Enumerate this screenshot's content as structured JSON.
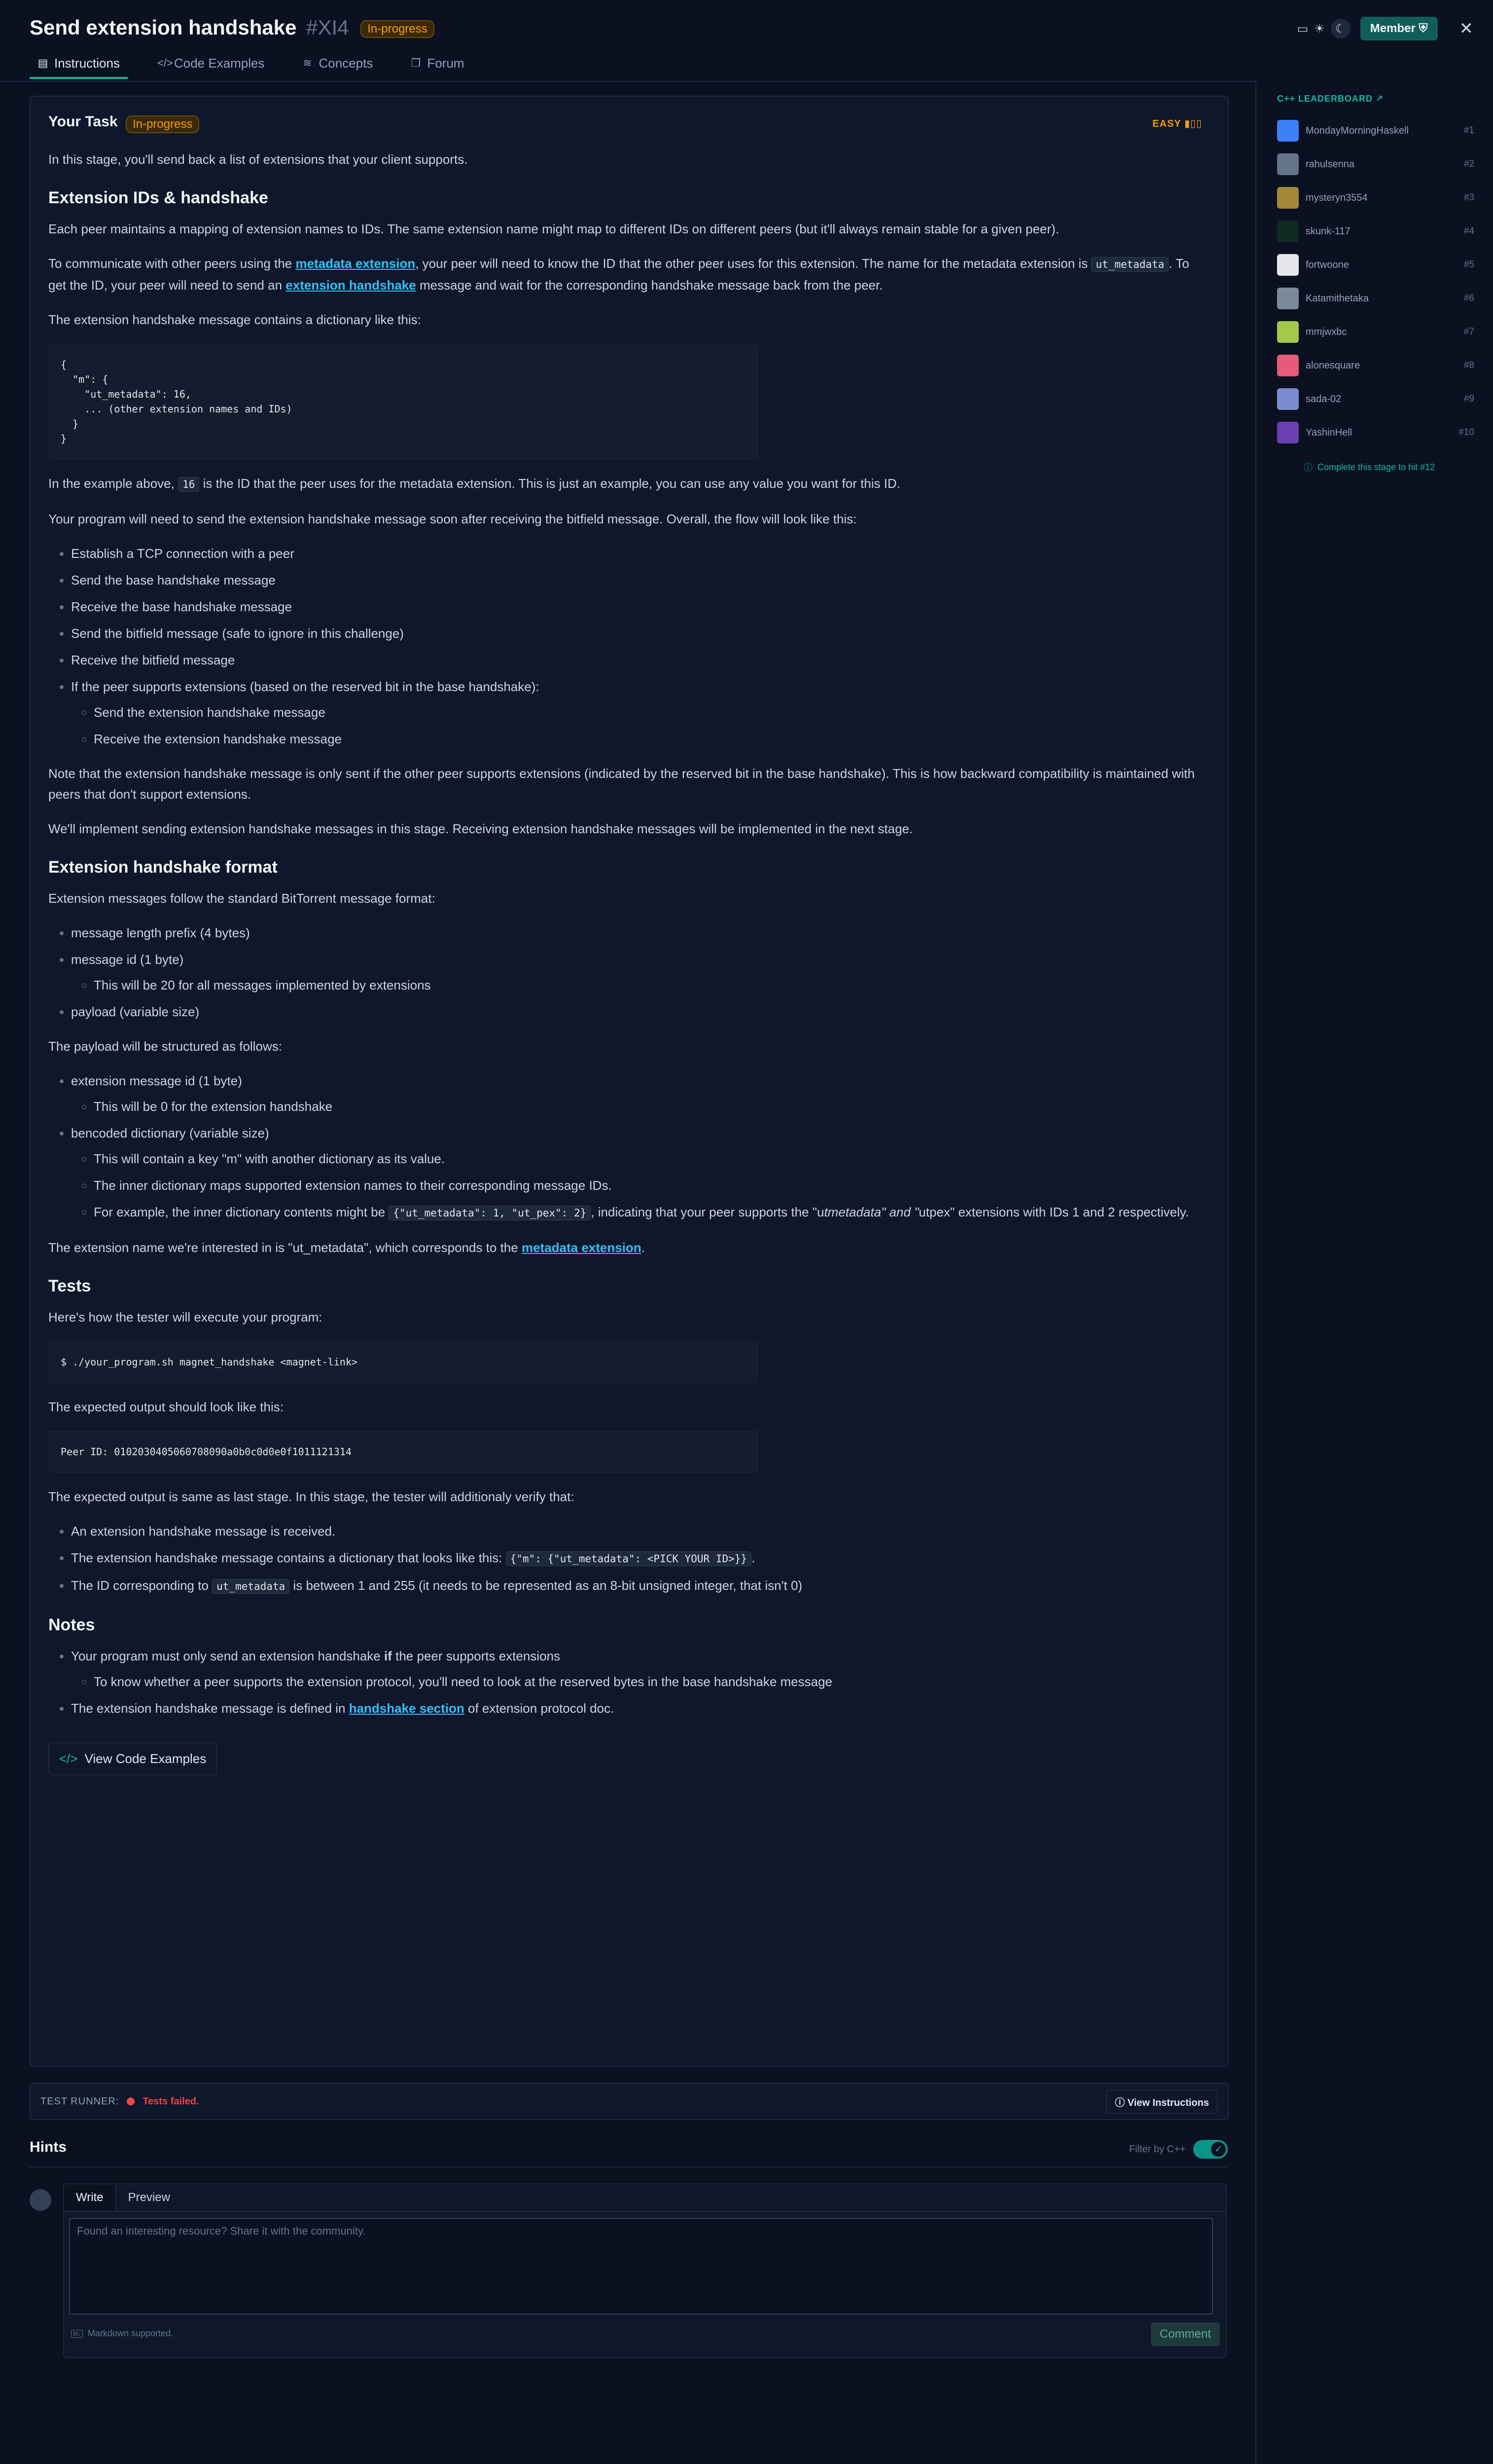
{
  "header": {
    "title": "Send extension handshake",
    "stage_id": "#XI4",
    "status": "In-progress",
    "member_label": "Member",
    "tabs": [
      "Instructions",
      "Code Examples",
      "Concepts",
      "Forum"
    ]
  },
  "task": {
    "heading": "Your Task",
    "status": "In-progress",
    "difficulty": "EASY",
    "intro": "In this stage, you'll send back a list of extensions that your client supports.",
    "h_ids": "Extension IDs & handshake",
    "p_ids": "Each peer maintains a mapping of extension names to IDs. The same extension name might map to different IDs on different peers (but it'll always remain stable for a given peer).",
    "p_comm_1": "To communicate with other peers using the ",
    "p_comm_link1": "metadata extension",
    "p_comm_2": ", your peer will need to know the ID that the other peer uses for this extension. The name for the metadata extension is ",
    "p_comm_code": "ut_metadata",
    "p_comm_3": ". To get the ID, your peer will need to send an ",
    "p_comm_link2": "extension handshake",
    "p_comm_4": " message and wait for the corresponding handshake message back from the peer.",
    "p_dict": "The extension handshake message contains a dictionary like this:",
    "code_dict": "{\n  \"m\": {\n    \"ut_metadata\": 16,\n    ... (other extension names and IDs)\n  }\n}",
    "p_ex_1": "In the example above, ",
    "p_ex_code": "16",
    "p_ex_2": " is the ID that the peer uses for the metadata extension. This is just an example, you can use any value you want for this ID.",
    "p_flow": "Your program will need to send the extension handshake message soon after receiving the bitfield message. Overall, the flow will look like this:",
    "flow": [
      "Establish a TCP connection with a peer",
      "Send the base handshake message",
      "Receive the base handshake message",
      "Send the bitfield message (safe to ignore in this challenge)",
      "Receive the bitfield message",
      "If the peer supports extensions (based on the reserved bit in the base handshake):"
    ],
    "flow_sub": [
      "Send the extension handshake message",
      "Receive the extension handshake message"
    ],
    "p_note": "Note that the extension handshake message is only sent if the other peer supports extensions (indicated by the reserved bit in the base handshake). This is how backward compatibility is maintained with peers that don't support extensions.",
    "p_impl": "We'll implement sending extension handshake messages in this stage. Receiving extension handshake messages will be implemented in the next stage.",
    "h_format": "Extension handshake format",
    "p_format": "Extension messages follow the standard BitTorrent message format:",
    "fmt_1": "message length prefix (4 bytes)",
    "fmt_2": "message id (1 byte)",
    "fmt_2_sub": "This will be 20 for all messages implemented by extensions",
    "fmt_3": "payload (variable size)",
    "p_payload": "The payload will be structured as follows:",
    "pl_1": "extension message id (1 byte)",
    "pl_1_sub": "This will be 0 for the extension handshake",
    "pl_2": "bencoded dictionary (variable size)",
    "pl_2_sub1": "This will contain a key \"m\" with another dictionary as its value.",
    "pl_2_sub2": "The inner dictionary maps supported extension names to their corresponding message IDs.",
    "pl_2_sub3_a": "For example, the inner dictionary contents might be ",
    "pl_2_sub3_code": "{\"ut_metadata\": 1, \"ut_pex\": 2}",
    "pl_2_sub3_b": ", indicating that your peer supports the \"u",
    "pl_2_sub3_i": "tmetadata\" and \"",
    "pl_2_sub3_c": "utpex\" extensions with IDs 1 and 2 respectively.",
    "p_interest_1": "The extension name we're interested in is \"ut_metadata\", which corresponds to the ",
    "p_interest_link": "metadata extension",
    "p_interest_2": ".",
    "h_tests": "Tests",
    "p_tests": "Here's how the tester will execute your program:",
    "code_cmd": "$ ./your_program.sh magnet_handshake <magnet-link>",
    "p_expected": "The expected output should look like this:",
    "code_out": "Peer ID: 0102030405060708090a0b0c0d0e0f1011121314",
    "p_verify": "The expected output is same as last stage. In this stage, the tester will additionaly verify that:",
    "v_1": "An extension handshake message is received.",
    "v_2_a": "The extension handshake message contains a dictionary that looks like this: ",
    "v_2_code": "{\"m\": {\"ut_metadata\": <PICK YOUR ID>}}",
    "v_2_b": ".",
    "v_3_a": "The ID corresponding to ",
    "v_3_code": "ut_metadata",
    "v_3_b": " is between 1 and 255 (it needs to be represented as an 8-bit unsigned integer, that isn't 0)",
    "h_notes": "Notes",
    "n_1_a": "Your program must only send an extension handshake ",
    "n_1_b": "if",
    "n_1_c": " the peer supports extensions",
    "n_1_sub": "To know whether a peer supports the extension protocol, you'll need to look at the reserved bytes in the base handshake message",
    "n_2_a": "The extension handshake message is defined in ",
    "n_2_link": "handshake section",
    "n_2_b": " of extension protocol doc.",
    "btn_code_examples": "View Code Examples"
  },
  "runner": {
    "label": "TEST RUNNER:",
    "status": "Tests failed.",
    "view_instructions": "View Instructions"
  },
  "hints": {
    "title": "Hints",
    "filter_label": "Filter by C++",
    "tab_write": "Write",
    "tab_preview": "Preview",
    "placeholder": "Found an interesting resource? Share it with the community.",
    "md_note": "Markdown supported.",
    "comment_btn": "Comment"
  },
  "leaderboard": {
    "title": "C++ LEADERBOARD ↗",
    "rows": [
      {
        "name": "MondayMorningHaskell",
        "rank": "#1",
        "color": "#3b82f6"
      },
      {
        "name": "rahulsenna",
        "rank": "#2",
        "color": "#64748b"
      },
      {
        "name": "mysteryn3554",
        "rank": "#3",
        "color": "#a3883a"
      },
      {
        "name": "skunk-117",
        "rank": "#4",
        "color": "#0f2a22"
      },
      {
        "name": "fortwoone",
        "rank": "#5",
        "color": "#e5e7eb"
      },
      {
        "name": "Katamithetaka",
        "rank": "#6",
        "color": "#7a8a99"
      },
      {
        "name": "mmjwxbc",
        "rank": "#7",
        "color": "#a3c94a"
      },
      {
        "name": "alonesquare",
        "rank": "#8",
        "color": "#e85a7a"
      },
      {
        "name": "sada-02",
        "rank": "#9",
        "color": "#7b8ccf"
      },
      {
        "name": "YashinHell",
        "rank": "#10",
        "color": "#6b3fb3"
      }
    ],
    "footer": "Complete this stage to hit #12"
  }
}
